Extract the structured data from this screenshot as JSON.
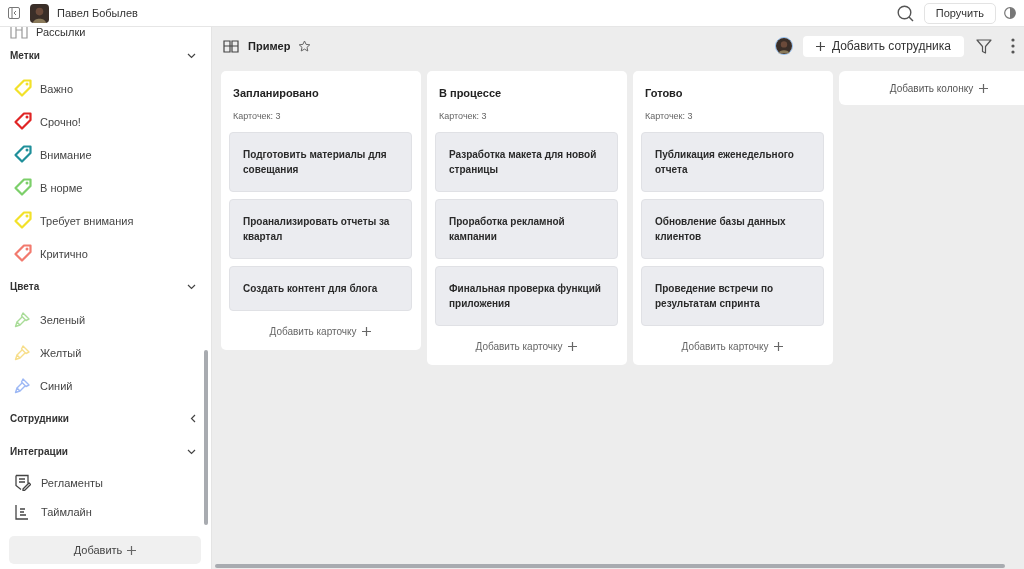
{
  "topbar": {
    "user_name": "Павел Бобылев",
    "assign_button": "Поручить"
  },
  "sidebar": {
    "top_item": "Рассылки",
    "sections": [
      {
        "title": "Метки",
        "expanded": true,
        "items": [
          {
            "kind": "tag",
            "label": "Важно",
            "color": "#f2e12a"
          },
          {
            "kind": "tag",
            "label": "Срочно!",
            "color": "#e02424"
          },
          {
            "kind": "tag",
            "label": "Внимание",
            "color": "#1f8f9a"
          },
          {
            "kind": "tag",
            "label": "В норме",
            "color": "#7ccf6a"
          },
          {
            "kind": "tag",
            "label": "Требует внимания",
            "color": "#f2e12a"
          },
          {
            "kind": "tag",
            "label": "Критично",
            "color": "#f27a6e"
          }
        ]
      },
      {
        "title": "Цвета",
        "expanded": true,
        "items": [
          {
            "kind": "brush",
            "label": "Зеленый",
            "color": "#a9dc98"
          },
          {
            "kind": "brush",
            "label": "Желтый",
            "color": "#f7de8a"
          },
          {
            "kind": "brush",
            "label": "Синий",
            "color": "#9db8f5"
          }
        ]
      },
      {
        "title": "Сотрудники",
        "expanded": false
      },
      {
        "title": "Интеграции",
        "expanded": true,
        "items": [
          {
            "kind": "document",
            "label": "Регламенты"
          },
          {
            "kind": "timeline",
            "label": "Таймлайн"
          }
        ]
      }
    ],
    "add_button": "Добавить"
  },
  "board": {
    "title": "Пример",
    "add_member_button": "Добавить сотрудника",
    "columns": [
      {
        "title": "Запланировано",
        "count": "Карточек: 3",
        "cards": [
          "Подготовить материалы для совещания",
          "Проанализировать отчеты за квартал",
          "Создать контент для блога"
        ],
        "add_card": "Добавить карточку"
      },
      {
        "title": "В процессе",
        "count": "Карточек: 3",
        "cards": [
          "Разработка макета для новой страницы",
          "Проработка рекламной кампании",
          "Финальная проверка функций приложения"
        ],
        "add_card": "Добавить карточку"
      },
      {
        "title": "Готово",
        "count": "Карточек: 3",
        "cards": [
          "Публикация еженедельного отчета",
          "Обновление базы данных клиентов",
          "Проведение встречи по результатам спринта"
        ],
        "add_card": "Добавить карточку"
      }
    ],
    "add_column": "Добавить колонку"
  }
}
